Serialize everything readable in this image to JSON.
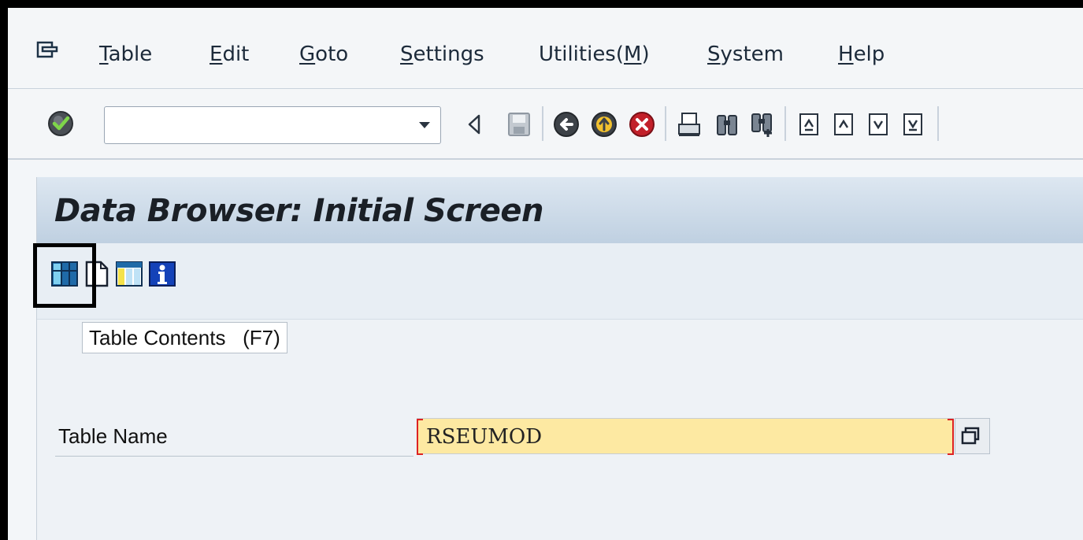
{
  "menu": {
    "items": [
      {
        "label": "Table",
        "key": "T",
        "rest": "able"
      },
      {
        "label": "Edit",
        "key": "E",
        "rest": "dit"
      },
      {
        "label": "Goto",
        "key": "G",
        "rest": "oto"
      },
      {
        "label": "Settings",
        "key": "S",
        "rest": "ettings"
      },
      {
        "label": "Utilities(M)",
        "pre": "Utilities(",
        "key": "M",
        "post": ")"
      },
      {
        "label": "System",
        "key": "S",
        "rest": "ystem"
      },
      {
        "label": "Help",
        "key": "H",
        "rest": "elp"
      }
    ]
  },
  "toolbar": {
    "command_value": "",
    "icons": [
      "enter-icon",
      "back-triangle-icon",
      "save-icon",
      "back-icon",
      "exit-icon",
      "cancel-icon",
      "print-icon",
      "find-icon",
      "find-next-icon",
      "first-page-icon",
      "previous-page-icon",
      "next-page-icon",
      "last-page-icon"
    ]
  },
  "page": {
    "title": "Data Browser: Initial Screen"
  },
  "app_toolbar": {
    "icons": [
      "table-contents-icon",
      "new-entries-icon",
      "table-fields-icon",
      "info-icon"
    ],
    "tooltip": "Table Contents   (F7)"
  },
  "form": {
    "table_name_label": "Table Name",
    "table_name_value": "RSEUMOD"
  },
  "colors": {
    "required_field_bg": "#fde9a2",
    "title_bar": "#bfd0e1",
    "required_marker": "#dd2222"
  }
}
